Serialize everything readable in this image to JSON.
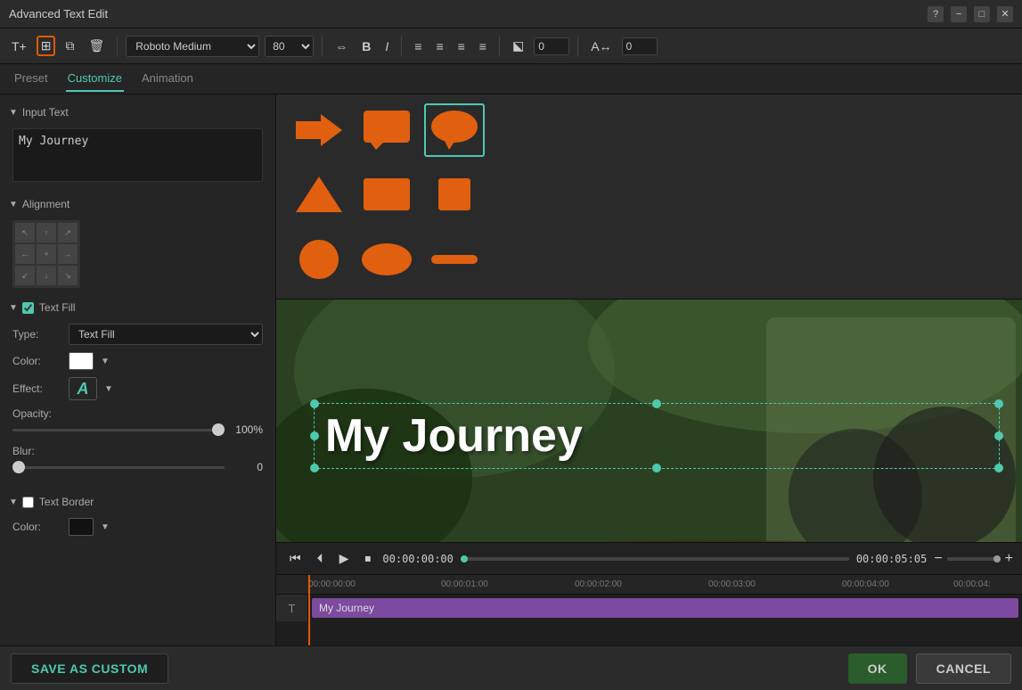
{
  "titlebar": {
    "title": "Advanced Text Edit"
  },
  "toolbar": {
    "font": "Roboto Medium",
    "font_size": "80",
    "spacing_value": "0",
    "kerning_value": "0"
  },
  "tabs": {
    "preset": "Preset",
    "customize": "Customize",
    "animation": "Animation",
    "active": "Customize"
  },
  "left_panel": {
    "input_text_section": "Input Text",
    "input_text_value": "My Journey",
    "alignment_section": "Alignment",
    "text_fill_section": "Text Fill",
    "text_fill_enabled": true,
    "type_label": "Type:",
    "type_value": "Text Fill",
    "color_label": "Color:",
    "effect_label": "Effect:",
    "effect_char": "A",
    "opacity_label": "Opacity:",
    "opacity_value": "100%",
    "blur_label": "Blur:",
    "blur_value": "0",
    "text_border_section": "Text Border",
    "text_border_enabled": false,
    "border_color_label": "Color:"
  },
  "shapes": [
    {
      "id": "arrow",
      "label": "arrow-shape"
    },
    {
      "id": "speech-bubble-square",
      "label": "speech-bubble-square"
    },
    {
      "id": "speech-bubble-round",
      "label": "speech-bubble-round",
      "selected": true
    },
    {
      "id": "triangle",
      "label": "triangle-shape"
    },
    {
      "id": "rectangle",
      "label": "rectangle-shape"
    },
    {
      "id": "small-square",
      "label": "small-square-shape"
    },
    {
      "id": "circle",
      "label": "circle-shape"
    },
    {
      "id": "oval",
      "label": "oval-shape"
    },
    {
      "id": "dash",
      "label": "dash-shape"
    }
  ],
  "preview": {
    "text": "My Journey"
  },
  "transport": {
    "time_current": "00:00:00:00",
    "time_total": "00:00:05:05"
  },
  "timeline": {
    "marks": [
      "00:00:00:00",
      "00:00:01:00",
      "00:00:02:00",
      "00:00:03:00",
      "00:00:04:00",
      "00:00:04:"
    ],
    "track_label": "My Journey"
  },
  "bottom": {
    "save_custom": "SAVE AS CUSTOM",
    "ok": "OK",
    "cancel": "CANCEL"
  }
}
